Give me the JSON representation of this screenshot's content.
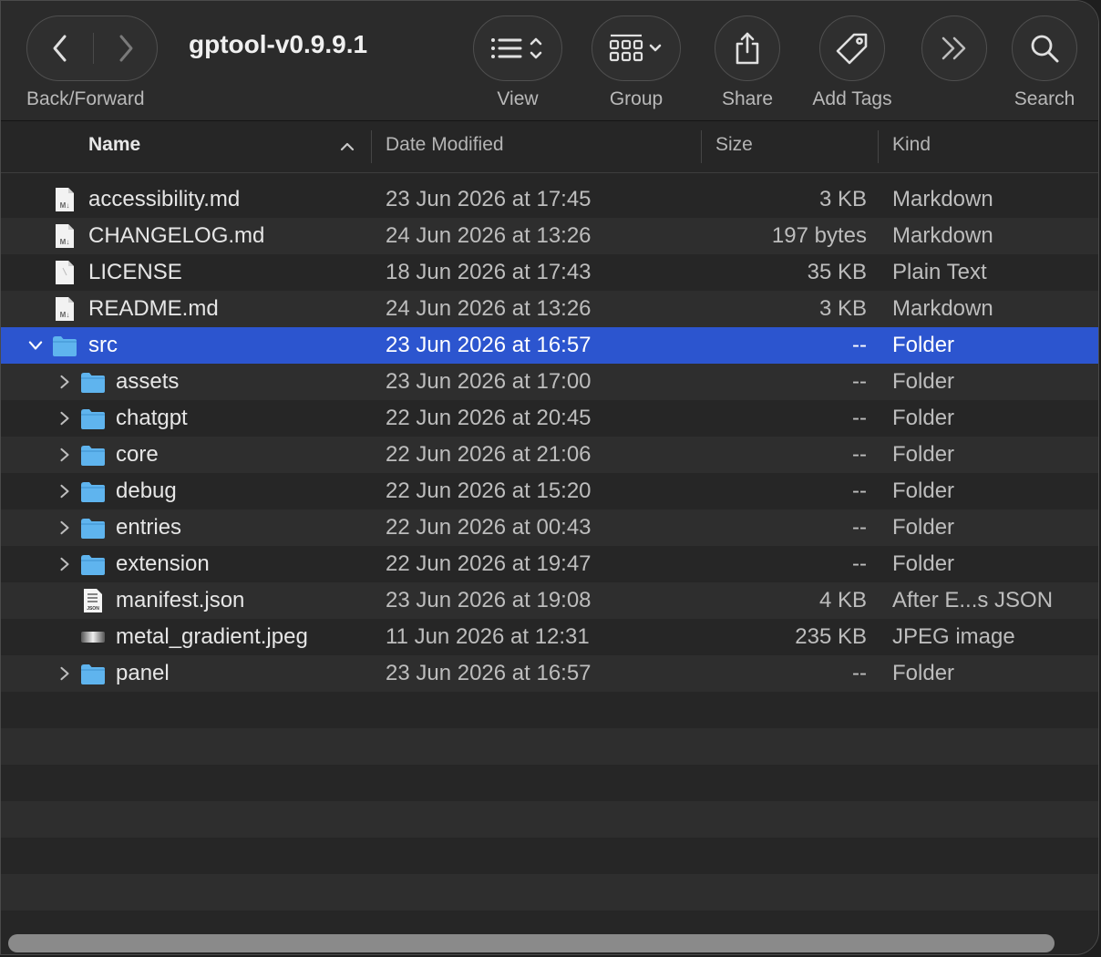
{
  "window": {
    "title": "gptool-v0.9.9.1"
  },
  "toolbar": {
    "back_forward_label": "Back/Forward",
    "view_label": "View",
    "group_label": "Group",
    "share_label": "Share",
    "add_tags_label": "Add Tags",
    "search_label": "Search",
    "icons": {
      "back": "chevron-left-icon",
      "forward": "chevron-right-icon",
      "view": "list-view-icon",
      "group": "group-grid-icon",
      "share": "share-icon",
      "tag": "tag-icon",
      "more": "double-chevron-icon",
      "search": "search-icon"
    }
  },
  "columns": {
    "name": "Name",
    "date_modified": "Date Modified",
    "size": "Size",
    "kind": "Kind",
    "sort_column": "Name",
    "sort_direction": "ascending"
  },
  "files": [
    {
      "name": "accessibility.md",
      "date": "23 Jun 2026 at 17:45",
      "size": "3 KB",
      "kind": "Markdown",
      "icon": "markdown-file-icon"
    },
    {
      "name": "CHANGELOG.md",
      "date": "24 Jun 2026 at 13:26",
      "size": "197 bytes",
      "kind": "Markdown",
      "icon": "markdown-file-icon"
    },
    {
      "name": "LICENSE",
      "date": "18 Jun 2026 at 17:43",
      "size": "35 KB",
      "kind": "Plain Text",
      "icon": "text-file-icon"
    },
    {
      "name": "README.md",
      "date": "24 Jun 2026 at 13:26",
      "size": "3 KB",
      "kind": "Markdown",
      "icon": "markdown-file-icon"
    },
    {
      "name": "src",
      "date": "23 Jun 2026 at 16:57",
      "size": "--",
      "kind": "Folder",
      "icon": "folder-icon",
      "expanded": true,
      "selected": true
    },
    {
      "name": "assets",
      "date": "23 Jun 2026 at 17:00",
      "size": "--",
      "kind": "Folder",
      "icon": "folder-icon"
    },
    {
      "name": "chatgpt",
      "date": "22 Jun 2026 at 20:45",
      "size": "--",
      "kind": "Folder",
      "icon": "folder-icon"
    },
    {
      "name": "core",
      "date": "22 Jun 2026 at 21:06",
      "size": "--",
      "kind": "Folder",
      "icon": "folder-icon"
    },
    {
      "name": "debug",
      "date": "22 Jun 2026 at 15:20",
      "size": "--",
      "kind": "Folder",
      "icon": "folder-icon"
    },
    {
      "name": "entries",
      "date": "22 Jun 2026 at 00:43",
      "size": "--",
      "kind": "Folder",
      "icon": "folder-icon"
    },
    {
      "name": "extension",
      "date": "22 Jun 2026 at 19:47",
      "size": "--",
      "kind": "Folder",
      "icon": "folder-icon"
    },
    {
      "name": "manifest.json",
      "date": "23 Jun 2026 at 19:08",
      "size": "4 KB",
      "kind": "After E...s JSON",
      "icon": "json-file-icon"
    },
    {
      "name": "metal_gradient.jpeg",
      "date": "11 Jun 2026 at 12:31",
      "size": "235 KB",
      "kind": "JPEG image",
      "icon": "jpeg-file-icon"
    },
    {
      "name": "panel",
      "date": "23 Jun 2026 at 16:57",
      "size": "--",
      "kind": "Folder",
      "icon": "folder-icon"
    }
  ],
  "colors": {
    "selection": "#2c55cf",
    "folder": "#5fb4ee",
    "background": "#262626",
    "row_alt": "#2e2e2e"
  }
}
